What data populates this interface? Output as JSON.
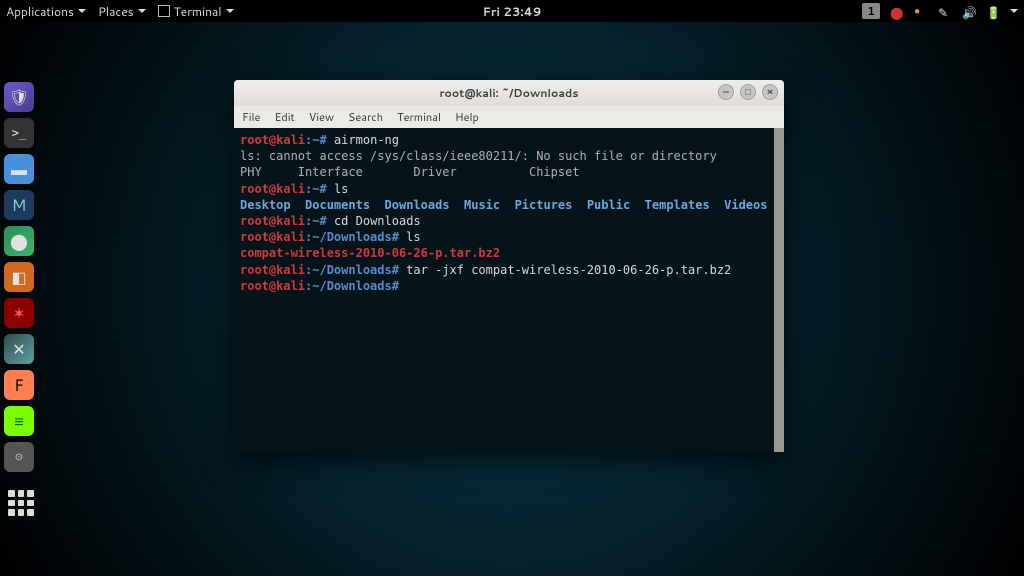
{
  "topbar": {
    "applications": "Applications",
    "places": "Places",
    "terminal": "Terminal",
    "clock": "Fri 23:49",
    "workspace": "1"
  },
  "window": {
    "title": "root@kali: ~/Downloads",
    "menu": {
      "file": "File",
      "edit": "Edit",
      "view": "View",
      "search": "Search",
      "terminal": "Terminal",
      "help": "Help"
    }
  },
  "terminal": {
    "l1_prompt_user": "root@kali",
    "l1_prompt_path": ":~#",
    "l1_cmd": " airmon-ng",
    "l2": "ls: cannot access /sys/class/ieee80211/: No such file or directory",
    "l3_blank": "",
    "l4_header": "PHY     Interface       Driver          Chipset",
    "l5_blank": "",
    "l6_prompt_user": "root@kali",
    "l6_prompt_path": ":~#",
    "l6_cmd": " ls",
    "l7_dirs": {
      "d1": "Desktop",
      "d2": "Documents",
      "d3": "Downloads",
      "d4": "Music",
      "d5": "Pictures",
      "d6": "Public",
      "d7": "Templates",
      "d8": "Videos"
    },
    "l8_prompt_user": "root@kali",
    "l8_prompt_path": ":~#",
    "l8_cmd": " cd Downloads",
    "l9_prompt_user": "root@kali",
    "l9_prompt_path": ":~/Downloads#",
    "l9_cmd": " ls",
    "l10_file": "compat-wireless-2010-06-26-p.tar.bz2",
    "l11_prompt_user": "root@kali",
    "l11_prompt_path": ":~/Downloads#",
    "l11_cmd": " tar -jxf compat-wireless-2010-06-26-p.tar.bz2",
    "l12_prompt_user": "root@kali",
    "l12_prompt_path": ":~/Downloads#",
    "l12_cmd": " "
  }
}
